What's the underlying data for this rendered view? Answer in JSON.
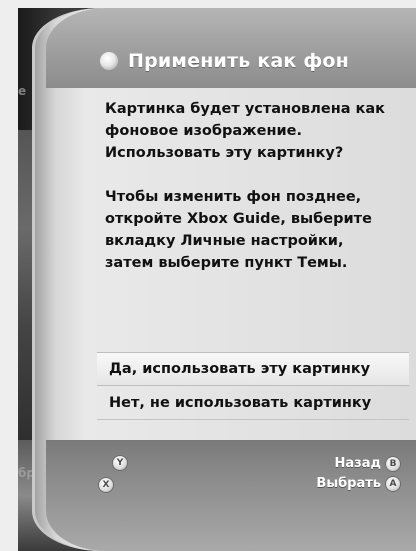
{
  "dialog": {
    "title": "Применить как фон",
    "title_icon": "xbox-orb-icon",
    "message_1": "Картинка будет установлена как\nфоновое изображение.\nИспользовать эту картинку?",
    "message_2": "Чтобы изменить фон позднее,\nоткройте Xbox Guide, выберите\nвкладку Личные настройки,\nзатем выберите пункт Темы."
  },
  "options": [
    {
      "label": "Да, использовать эту картинку",
      "selected": true
    },
    {
      "label": "Нет, не использовать картинку",
      "selected": false
    }
  ],
  "footer": {
    "y_glyph": "Y",
    "x_glyph": "X",
    "back_label": "Назад",
    "back_glyph": "B",
    "select_label": "Выбрать",
    "select_glyph": "A"
  },
  "background_partial": {
    "left_text_1": "е",
    "left_text_2": "бр"
  }
}
